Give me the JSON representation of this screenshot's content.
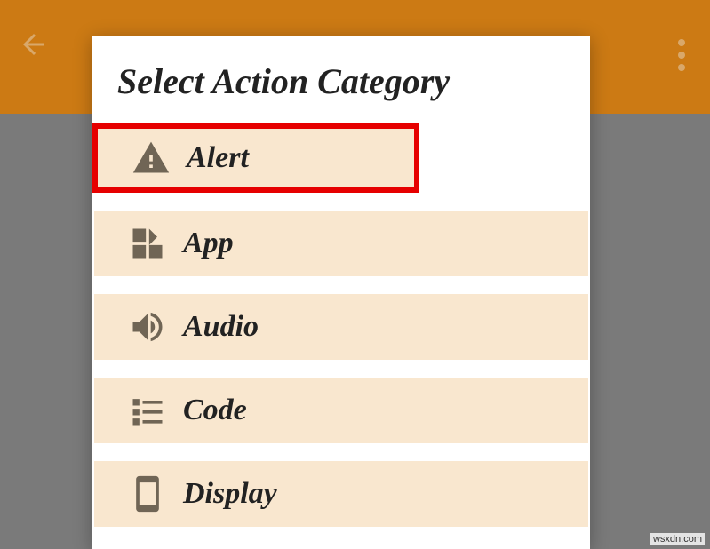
{
  "dialog": {
    "title": "Select Action Category",
    "categories": [
      {
        "id": "alert",
        "label": "Alert",
        "icon": "alert-triangle",
        "highlighted": true
      },
      {
        "id": "app",
        "label": "App",
        "icon": "widgets",
        "highlighted": false
      },
      {
        "id": "audio",
        "label": "Audio",
        "icon": "volume",
        "highlighted": false
      },
      {
        "id": "code",
        "label": "Code",
        "icon": "list",
        "highlighted": false
      },
      {
        "id": "display",
        "label": "Display",
        "icon": "phone",
        "highlighted": false
      }
    ]
  },
  "watermark": "wsxdn.com"
}
